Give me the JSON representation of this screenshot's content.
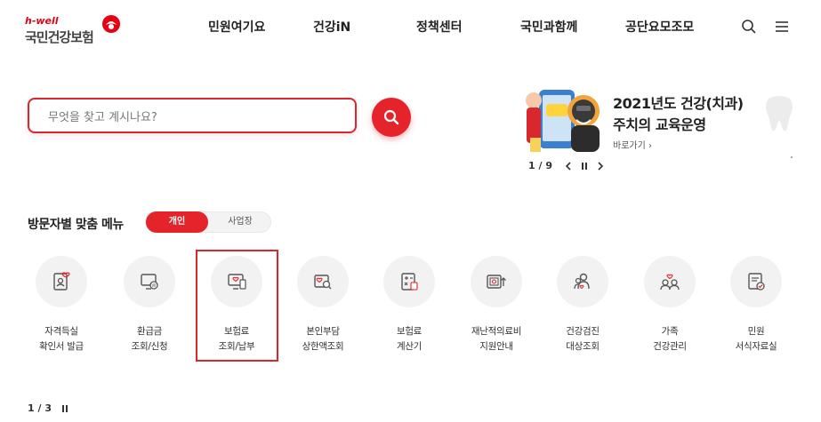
{
  "header": {
    "logo": {
      "tagline": "h-well",
      "name": "국민건강보험"
    },
    "nav": [
      "민원여기요",
      "건강iN",
      "정책센터",
      "국민과함께",
      "공단요모조모"
    ],
    "icons": [
      "search-icon",
      "menu-icon"
    ]
  },
  "search": {
    "placeholder": "무엇을 찾고 계시나요?",
    "value": ""
  },
  "banner": {
    "title_line1": "2021년도 건강(치과)",
    "title_line2": "주치의 교육운영",
    "link": "바로가기 ›",
    "pager": "1 / 9"
  },
  "visitor_menu": {
    "title": "방문자별 맞춤 메뉴",
    "tabs": {
      "active": "개인",
      "inactive": "사업장"
    },
    "items": [
      {
        "line1": "자격득실",
        "line2": "확인서 발급",
        "icon": "certificate-icon"
      },
      {
        "line1": "환급금",
        "line2": "조회/신청",
        "icon": "refund-monitor-icon"
      },
      {
        "line1": "보험료",
        "line2": "조회/납부",
        "icon": "premium-payment-icon"
      },
      {
        "line1": "본인부담",
        "line2": "상한액조회",
        "icon": "copay-search-icon"
      },
      {
        "line1": "보험료",
        "line2": "계산기",
        "icon": "calculator-icon"
      },
      {
        "line1": "재난적의료비",
        "line2": "지원안내",
        "icon": "medical-support-icon"
      },
      {
        "line1": "건강검진",
        "line2": "대상조회",
        "icon": "checkup-people-icon"
      },
      {
        "line1": "가족",
        "line2": "건강관리",
        "icon": "family-health-icon"
      },
      {
        "line1": "민원",
        "line2": "서식자료실",
        "icon": "forms-icon"
      }
    ],
    "pager": "1 / 3"
  },
  "colors": {
    "accent": "#e4232b",
    "text": "#222222",
    "icon_bg": "#f2f2f2"
  }
}
